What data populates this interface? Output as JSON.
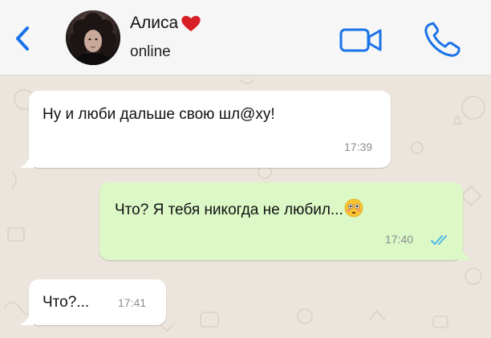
{
  "header": {
    "contact_name": "Алиса",
    "status": "online"
  },
  "icons": {
    "back": "chevron-left-icon",
    "video": "video-camera-icon",
    "call": "phone-icon",
    "heart": "red-heart-icon",
    "emoji": "flushed-face-emoji-icon",
    "read": "double-check-icon"
  },
  "colors": {
    "accent": "#1a73e8",
    "incoming_bubble": "#ffffff",
    "outgoing_bubble": "#dcf8c6",
    "read_ticks": "#4fb6ec",
    "chat_background": "#ece5dd"
  },
  "messages": [
    {
      "direction": "incoming",
      "text": "Ну и люби дальше свою шл@ху!",
      "time": "17:39"
    },
    {
      "direction": "outgoing",
      "text": "Что? Я тебя никогда не любил...",
      "time": "17:40",
      "status": "read"
    },
    {
      "direction": "incoming",
      "text": "Что?...",
      "time": "17:41"
    }
  ]
}
